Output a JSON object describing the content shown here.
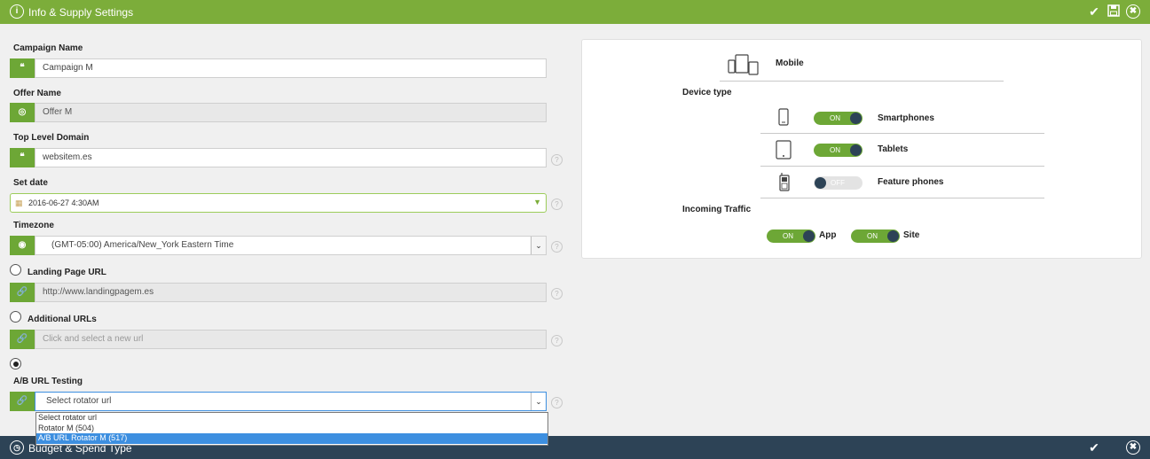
{
  "header": {
    "title": "Info & Supply Settings"
  },
  "footer": {
    "title": "Budget & Spend Type"
  },
  "form": {
    "campaign_name": {
      "label": "Campaign Name",
      "value": "Campaign M"
    },
    "offer_name": {
      "label": "Offer Name",
      "value": "Offer M"
    },
    "tld": {
      "label": "Top Level Domain",
      "value": "websitem.es"
    },
    "set_date": {
      "label": "Set date",
      "value": "2016-06-27 4:30AM"
    },
    "timezone": {
      "label": "Timezone",
      "value": "(GMT-05:00) America/New_York Eastern Time"
    },
    "landing_page": {
      "label": "Landing Page URL",
      "value": "http://www.landingpagem.es"
    },
    "additional_urls": {
      "label": "Additional URLs",
      "placeholder": "Click and select a new url"
    },
    "ab_testing": {
      "label": "A/B URL Testing",
      "value": "Select rotator url",
      "options": [
        "Select rotator url",
        "Rotator M (504)",
        "A/B URL Rotator M (517)"
      ],
      "selected_index": 2
    }
  },
  "devices": {
    "mobile_label": "Mobile",
    "device_type_label": "Device type",
    "items": [
      {
        "label": "Smartphones",
        "state": "ON"
      },
      {
        "label": "Tablets",
        "state": "ON"
      },
      {
        "label": "Feature phones",
        "state": "OFF"
      }
    ],
    "incoming_traffic_label": "Incoming Traffic",
    "traffic": [
      {
        "label": "App",
        "state": "ON"
      },
      {
        "label": "Site",
        "state": "ON"
      }
    ]
  },
  "help_glyph": "?",
  "colors": {
    "primary": "#7cad3a",
    "addon": "#6da736",
    "dark": "#2d4356",
    "selected": "#3d8fe0"
  }
}
